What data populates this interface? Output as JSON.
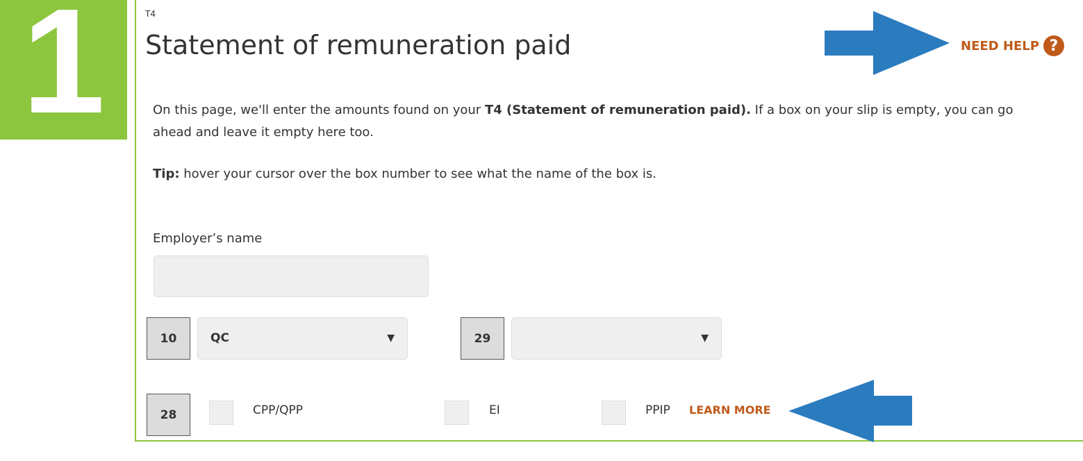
{
  "step_number": "1",
  "form_code": "T4",
  "page_title": "Statement of remuneration paid",
  "need_help_label": "NEED HELP",
  "intro": {
    "before": "On this page, we'll enter the amounts found on your ",
    "bold": "T4 (Statement of remuneration paid).",
    "after": " If a box on your slip is empty, you can go ahead and leave it empty here too."
  },
  "tip": {
    "bold": "Tip:",
    "text": " hover your cursor over the box number to see what the name of the box is."
  },
  "employer_name": {
    "label": "Employer’s name",
    "value": "",
    "placeholder": ""
  },
  "box10": {
    "number": "10",
    "selected": "QC"
  },
  "box29": {
    "number": "29",
    "selected": ""
  },
  "box28": {
    "number": "28",
    "checkboxes": [
      {
        "label": "CPP/QPP",
        "checked": false
      },
      {
        "label": "EI",
        "checked": false
      },
      {
        "label": "PPIP",
        "checked": false
      }
    ],
    "learn_more_label": "LEARN MORE"
  },
  "colors": {
    "accent_green": "#8cc63f",
    "link_orange": "#bf5a1a",
    "annotation_arrow_blue": "#2b7bbf"
  },
  "icons": {
    "help": "question-circle-icon",
    "dropdown": "chevron-down-icon",
    "annotation": "arrow-icon"
  }
}
